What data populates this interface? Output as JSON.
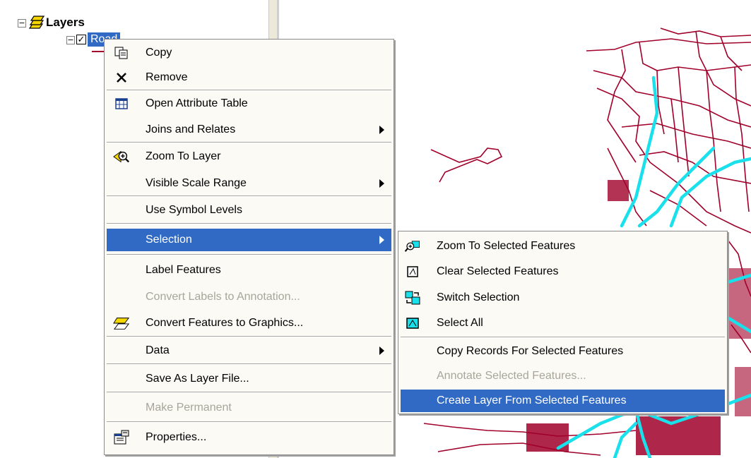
{
  "toc": {
    "root_label": "Layers",
    "layer_label": "Road",
    "root_expander": "−",
    "layer_expander": "−",
    "checkbox": "✓"
  },
  "context_menu": {
    "items": [
      {
        "label": "Copy",
        "icon": "copy-icon"
      },
      {
        "label": "Remove",
        "icon": "remove-icon"
      },
      {
        "label": "Open Attribute Table",
        "icon": "table-icon"
      },
      {
        "label": "Joins and Relates",
        "submenu": true
      },
      {
        "label": "Zoom To Layer",
        "icon": "zoom-to-layer-icon"
      },
      {
        "label": "Visible Scale Range",
        "submenu": true
      },
      {
        "label": "Use Symbol Levels"
      },
      {
        "label": "Selection",
        "submenu": true,
        "highlighted": true
      },
      {
        "label": "Label Features"
      },
      {
        "label": "Convert Labels to Annotation...",
        "disabled": true
      },
      {
        "label": "Convert Features to Graphics...",
        "icon": "convert-graphics-icon"
      },
      {
        "label": "Data",
        "submenu": true
      },
      {
        "label": "Save As Layer File..."
      },
      {
        "label": "Make Permanent",
        "disabled": true
      },
      {
        "label": "Properties...",
        "icon": "properties-icon"
      }
    ]
  },
  "selection_submenu": {
    "items": [
      {
        "label": "Zoom To Selected Features",
        "icon": "zoom-selected-icon"
      },
      {
        "label": "Clear Selected Features",
        "icon": "clear-selection-icon"
      },
      {
        "label": "Switch Selection",
        "icon": "switch-selection-icon"
      },
      {
        "label": "Select All",
        "icon": "select-all-icon"
      },
      {
        "label": "Copy Records For Selected Features"
      },
      {
        "label": "Annotate Selected Features...",
        "disabled": true
      },
      {
        "label": "Create Layer From Selected Features",
        "highlighted": true
      }
    ]
  },
  "colors": {
    "highlight": "#316ac5",
    "road": "#a0002a",
    "selected_road": "#19e0ea",
    "menu_bg": "#fbfaf5"
  }
}
